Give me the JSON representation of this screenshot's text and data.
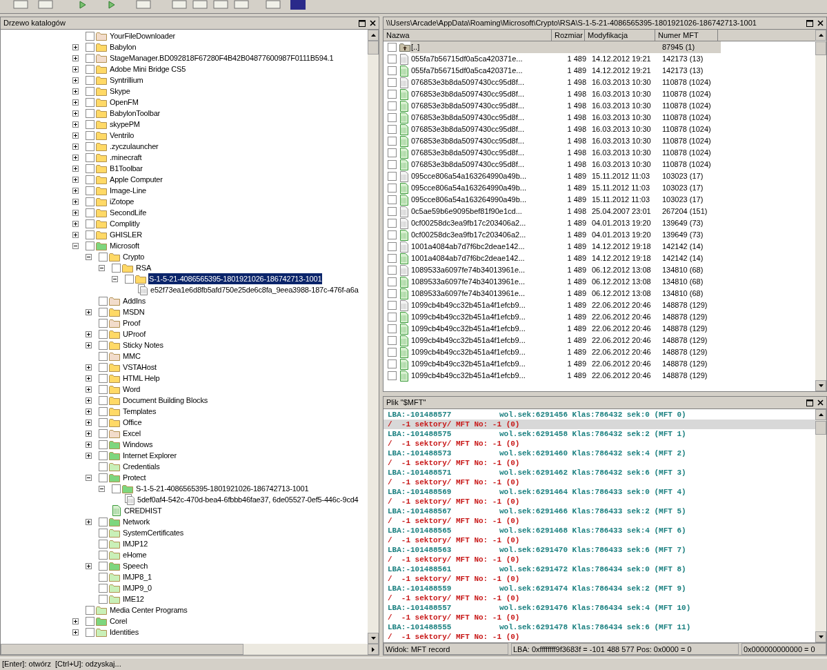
{
  "tree_panel": {
    "title": "Drzewo katalogów",
    "nodes": [
      {
        "label": "YourFileDownloader",
        "kind": "folder",
        "color": "#f2dccb",
        "checked": false,
        "selected": false
      },
      {
        "label": "Babylon",
        "kind": "branch",
        "expanded": false,
        "color": "#ffd966",
        "checked": false,
        "selected": false
      },
      {
        "label": "StageManager.BD092818F67280F4B42B04877600987F0111B594.1",
        "kind": "branch",
        "expanded": false,
        "color": "#f2dccb",
        "checked": false,
        "selected": false
      },
      {
        "label": "Adobe Mini Bridge CS5",
        "kind": "branch",
        "expanded": false,
        "color": "#ffd966",
        "checked": false,
        "selected": false
      },
      {
        "label": "Syntrillium",
        "kind": "branch",
        "expanded": false,
        "color": "#ffd966",
        "checked": false,
        "selected": false
      },
      {
        "label": "Skype",
        "kind": "branch",
        "expanded": false,
        "color": "#ffd966",
        "checked": false,
        "selected": false
      },
      {
        "label": "OpenFM",
        "kind": "branch",
        "expanded": false,
        "color": "#ffd966",
        "checked": false,
        "selected": false
      },
      {
        "label": "BabylonToolbar",
        "kind": "branch",
        "expanded": false,
        "color": "#ffd966",
        "checked": false,
        "selected": false
      },
      {
        "label": "skypePM",
        "kind": "branch",
        "expanded": false,
        "color": "#ffd966",
        "checked": false,
        "selected": false
      },
      {
        "label": "Ventrilo",
        "kind": "branch",
        "expanded": false,
        "color": "#ffd966",
        "checked": false,
        "selected": false
      },
      {
        "label": ".zyczulauncher",
        "kind": "branch",
        "expanded": false,
        "color": "#ffd966",
        "checked": false,
        "selected": false
      },
      {
        "label": ".minecraft",
        "kind": "branch",
        "expanded": false,
        "color": "#ffd966",
        "checked": false,
        "selected": false
      },
      {
        "label": "B1Toolbar",
        "kind": "branch",
        "expanded": false,
        "color": "#ffd966",
        "checked": false,
        "selected": false
      },
      {
        "label": "Apple Computer",
        "kind": "branch",
        "expanded": false,
        "color": "#ffd966",
        "checked": false,
        "selected": false
      },
      {
        "label": "Image-Line",
        "kind": "branch",
        "expanded": false,
        "color": "#ffd966",
        "checked": false,
        "selected": false
      },
      {
        "label": "iZotope",
        "kind": "branch",
        "expanded": false,
        "color": "#ffd966",
        "checked": false,
        "selected": false
      },
      {
        "label": "SecondLife",
        "kind": "branch",
        "expanded": false,
        "color": "#ffd966",
        "checked": false,
        "selected": false
      },
      {
        "label": "Complitly",
        "kind": "branch",
        "expanded": false,
        "color": "#ffd966",
        "checked": false,
        "selected": false
      },
      {
        "label": "GHISLER",
        "kind": "branch",
        "expanded": false,
        "color": "#ffd966",
        "checked": false,
        "selected": false
      },
      {
        "label": "Microsoft",
        "kind": "branch",
        "expanded": true,
        "color": "#7ed67e",
        "checked": false,
        "selected": false,
        "children": [
          {
            "label": "Crypto",
            "kind": "branch",
            "expanded": true,
            "color": "#ffd966",
            "checked": false,
            "selected": false,
            "children": [
              {
                "label": "RSA",
                "kind": "branch",
                "expanded": true,
                "color": "#ffd966",
                "checked": false,
                "selected": false,
                "children": [
                  {
                    "label": "S-1-5-21-4086565395-1801921026-186742713-1001",
                    "kind": "branch",
                    "expanded": true,
                    "color": "#ffd966",
                    "checked": false,
                    "selected": true,
                    "children": [
                      {
                        "label": "e52f73ea1e6d8fb5afd750e25de6c8fa_9eea3988-187c-476f-a6a",
                        "kind": "file-stack",
                        "selected": false
                      }
                    ]
                  }
                ]
              }
            ]
          },
          {
            "label": "AddIns",
            "kind": "folder",
            "color": "#f2dccb",
            "checked": false,
            "selected": false
          },
          {
            "label": "MSDN",
            "kind": "branch",
            "expanded": false,
            "color": "#ffd966",
            "checked": false,
            "selected": false
          },
          {
            "label": "Proof",
            "kind": "folder",
            "color": "#f2dccb",
            "checked": false,
            "selected": false
          },
          {
            "label": "UProof",
            "kind": "branch",
            "expanded": false,
            "color": "#ffd966",
            "checked": false,
            "selected": false
          },
          {
            "label": "Sticky Notes",
            "kind": "branch",
            "expanded": false,
            "color": "#ffd966",
            "checked": false,
            "selected": false
          },
          {
            "label": "MMC",
            "kind": "folder",
            "color": "#f2dccb",
            "checked": false,
            "selected": false
          },
          {
            "label": "VSTAHost",
            "kind": "branch",
            "expanded": false,
            "color": "#ffd966",
            "checked": false,
            "selected": false
          },
          {
            "label": "HTML Help",
            "kind": "branch",
            "expanded": false,
            "color": "#ffd966",
            "checked": false,
            "selected": false
          },
          {
            "label": "Word",
            "kind": "branch",
            "expanded": false,
            "color": "#ffd966",
            "checked": false,
            "selected": false
          },
          {
            "label": "Document Building Blocks",
            "kind": "branch",
            "expanded": false,
            "color": "#ffd966",
            "checked": false,
            "selected": false
          },
          {
            "label": "Templates",
            "kind": "branch",
            "expanded": false,
            "color": "#ffd966",
            "checked": false,
            "selected": false
          },
          {
            "label": "Office",
            "kind": "branch",
            "expanded": false,
            "color": "#ffd966",
            "checked": false,
            "selected": false
          },
          {
            "label": "Excel",
            "kind": "branch",
            "expanded": false,
            "color": "#f2dccb",
            "checked": false,
            "selected": false
          },
          {
            "label": "Windows",
            "kind": "branch",
            "expanded": false,
            "color": "#7ed67e",
            "checked": false,
            "selected": false
          },
          {
            "label": "Internet Explorer",
            "kind": "branch",
            "expanded": false,
            "color": "#7ed67e",
            "checked": false,
            "selected": false
          },
          {
            "label": "Credentials",
            "kind": "folder",
            "color": "#c9f0b8",
            "checked": false,
            "selected": false
          },
          {
            "label": "Protect",
            "kind": "branch",
            "expanded": true,
            "color": "#7ed67e",
            "checked": false,
            "selected": false,
            "children": [
              {
                "label": "S-1-5-21-4086565395-1801921026-186742713-1001",
                "kind": "branch",
                "expanded": true,
                "color": "#7ed67e",
                "checked": false,
                "selected": false,
                "children": [
                  {
                    "label": "5def0af4-542c-470d-bea4-6fbbb46fae37, 6de05527-0ef5-446c-9cd4",
                    "kind": "file-stack",
                    "selected": false
                  }
                ]
              },
              {
                "label": "CREDHIST",
                "kind": "file",
                "selected": false
              }
            ]
          },
          {
            "label": "Network",
            "kind": "branch",
            "expanded": false,
            "color": "#7ed67e",
            "checked": false,
            "selected": false
          },
          {
            "label": "SystemCertificates",
            "kind": "folder",
            "color": "#c9f0b8",
            "checked": false,
            "selected": false
          },
          {
            "label": "IMJP12",
            "kind": "folder",
            "color": "#c9f0b8",
            "checked": false,
            "selected": false
          },
          {
            "label": "eHome",
            "kind": "folder",
            "color": "#c9f0b8",
            "checked": false,
            "selected": false
          },
          {
            "label": "Speech",
            "kind": "branch",
            "expanded": false,
            "color": "#7ed67e",
            "checked": false,
            "selected": false
          },
          {
            "label": "IMJP8_1",
            "kind": "folder",
            "color": "#c9f0b8",
            "checked": false,
            "selected": false
          },
          {
            "label": "IMJP9_0",
            "kind": "folder",
            "color": "#c9f0b8",
            "checked": false,
            "selected": false
          },
          {
            "label": "IME12",
            "kind": "folder",
            "color": "#c9f0b8",
            "checked": false,
            "selected": false
          }
        ]
      },
      {
        "label": "Media Center Programs",
        "kind": "folder",
        "color": "#c9f0b8",
        "checked": false,
        "selected": false
      },
      {
        "label": "Corel",
        "kind": "branch",
        "expanded": false,
        "color": "#7ed67e",
        "checked": false,
        "selected": false
      },
      {
        "label": "Identities",
        "kind": "branch",
        "expanded": false,
        "color": "#c9f0b8",
        "checked": false,
        "selected": false
      }
    ]
  },
  "file_panel": {
    "title": "\\\\Users\\Arcade\\AppData\\Roaming\\Microsoft\\Crypto\\RSA\\S-1-5-21-4086565395-1801921026-186742713-1001",
    "columns": [
      "Nazwa",
      "Rozmiar",
      "Modyfikacja",
      "Numer MFT"
    ],
    "rows": [
      {
        "kind": "parent",
        "name": "[..]",
        "mft": "87945 (1)",
        "checked": false,
        "selected": true
      },
      {
        "kind": "plain",
        "name": "055fa7b56715df0a5ca420371e...",
        "size": "1 489",
        "modified": "14.12.2012 19:21",
        "mft": "142173 (13)",
        "checked": false,
        "selected": false
      },
      {
        "kind": "green",
        "name": "055fa7b56715df0a5ca420371e...",
        "size": "1 489",
        "modified": "14.12.2012 19:21",
        "mft": "142173 (13)",
        "checked": false,
        "selected": false
      },
      {
        "kind": "plain",
        "name": "076853e3b8da5097430cc95d8f...",
        "size": "1 498",
        "modified": "16.03.2013 10:30",
        "mft": "110878 (1024)",
        "checked": false,
        "selected": false
      },
      {
        "kind": "green",
        "name": "076853e3b8da5097430cc95d8f...",
        "size": "1 498",
        "modified": "16.03.2013 10:30",
        "mft": "110878 (1024)",
        "checked": false,
        "selected": false
      },
      {
        "kind": "green",
        "name": "076853e3b8da5097430cc95d8f...",
        "size": "1 498",
        "modified": "16.03.2013 10:30",
        "mft": "110878 (1024)",
        "checked": false,
        "selected": false
      },
      {
        "kind": "green",
        "name": "076853e3b8da5097430cc95d8f...",
        "size": "1 498",
        "modified": "16.03.2013 10:30",
        "mft": "110878 (1024)",
        "checked": false,
        "selected": false
      },
      {
        "kind": "green",
        "name": "076853e3b8da5097430cc95d8f...",
        "size": "1 498",
        "modified": "16.03.2013 10:30",
        "mft": "110878 (1024)",
        "checked": false,
        "selected": false
      },
      {
        "kind": "green",
        "name": "076853e3b8da5097430cc95d8f...",
        "size": "1 498",
        "modified": "16.03.2013 10:30",
        "mft": "110878 (1024)",
        "checked": false,
        "selected": false
      },
      {
        "kind": "green",
        "name": "076853e3b8da5097430cc95d8f...",
        "size": "1 498",
        "modified": "16.03.2013 10:30",
        "mft": "110878 (1024)",
        "checked": false,
        "selected": false
      },
      {
        "kind": "green",
        "name": "076853e3b8da5097430cc95d8f...",
        "size": "1 498",
        "modified": "16.03.2013 10:30",
        "mft": "110878 (1024)",
        "checked": false,
        "selected": false
      },
      {
        "kind": "plain",
        "name": "095cce806a54a163264990a49b...",
        "size": "1 489",
        "modified": "15.11.2012 11:03",
        "mft": "103023 (17)",
        "checked": false,
        "selected": false
      },
      {
        "kind": "green",
        "name": "095cce806a54a163264990a49b...",
        "size": "1 489",
        "modified": "15.11.2012 11:03",
        "mft": "103023 (17)",
        "checked": false,
        "selected": false
      },
      {
        "kind": "green",
        "name": "095cce806a54a163264990a49b...",
        "size": "1 489",
        "modified": "15.11.2012 11:03",
        "mft": "103023 (17)",
        "checked": false,
        "selected": false
      },
      {
        "kind": "plain",
        "name": "0c5ae59b6e9095bef81f90e1cd...",
        "size": "1 498",
        "modified": "25.04.2007 23:01",
        "mft": "267204 (151)",
        "checked": false,
        "selected": false
      },
      {
        "kind": "plain",
        "name": "0cf00258dc3ea9fb17c203406a2...",
        "size": "1 489",
        "modified": "04.01.2013 19:20",
        "mft": "139649 (73)",
        "checked": false,
        "selected": false
      },
      {
        "kind": "green",
        "name": "0cf00258dc3ea9fb17c203406a2...",
        "size": "1 489",
        "modified": "04.01.2013 19:20",
        "mft": "139649 (73)",
        "checked": false,
        "selected": false
      },
      {
        "kind": "plain",
        "name": "1001a4084ab7d7f6bc2deae142...",
        "size": "1 489",
        "modified": "14.12.2012 19:18",
        "mft": "142142 (14)",
        "checked": false,
        "selected": false
      },
      {
        "kind": "green",
        "name": "1001a4084ab7d7f6bc2deae142...",
        "size": "1 489",
        "modified": "14.12.2012 19:18",
        "mft": "142142 (14)",
        "checked": false,
        "selected": false
      },
      {
        "kind": "plain",
        "name": "1089533a6097fe74b34013961e...",
        "size": "1 489",
        "modified": "06.12.2012 13:08",
        "mft": "134810 (68)",
        "checked": false,
        "selected": false
      },
      {
        "kind": "green",
        "name": "1089533a6097fe74b34013961e...",
        "size": "1 489",
        "modified": "06.12.2012 13:08",
        "mft": "134810 (68)",
        "checked": false,
        "selected": false
      },
      {
        "kind": "green",
        "name": "1089533a6097fe74b34013961e...",
        "size": "1 489",
        "modified": "06.12.2012 13:08",
        "mft": "134810 (68)",
        "checked": false,
        "selected": false
      },
      {
        "kind": "plain",
        "name": "1099cb4b49cc32b451a4f1efcb9...",
        "size": "1 489",
        "modified": "22.06.2012 20:46",
        "mft": "148878 (129)",
        "checked": false,
        "selected": false
      },
      {
        "kind": "green",
        "name": "1099cb4b49cc32b451a4f1efcb9...",
        "size": "1 489",
        "modified": "22.06.2012 20:46",
        "mft": "148878 (129)",
        "checked": false,
        "selected": false
      },
      {
        "kind": "green",
        "name": "1099cb4b49cc32b451a4f1efcb9...",
        "size": "1 489",
        "modified": "22.06.2012 20:46",
        "mft": "148878 (129)",
        "checked": false,
        "selected": false
      },
      {
        "kind": "green",
        "name": "1099cb4b49cc32b451a4f1efcb9...",
        "size": "1 489",
        "modified": "22.06.2012 20:46",
        "mft": "148878 (129)",
        "checked": false,
        "selected": false
      },
      {
        "kind": "green",
        "name": "1099cb4b49cc32b451a4f1efcb9...",
        "size": "1 489",
        "modified": "22.06.2012 20:46",
        "mft": "148878 (129)",
        "checked": false,
        "selected": false
      },
      {
        "kind": "green",
        "name": "1099cb4b49cc32b451a4f1efcb9...",
        "size": "1 489",
        "modified": "22.06.2012 20:46",
        "mft": "148878 (129)",
        "checked": false,
        "selected": false
      },
      {
        "kind": "green",
        "name": "1099cb4b49cc32b451a4f1efcb9...",
        "size": "1 489",
        "modified": "22.06.2012 20:46",
        "mft": "148878 (129)",
        "checked": false,
        "selected": false
      }
    ]
  },
  "mft_panel": {
    "title": "Plik \"$MFT\"",
    "lines": [
      {
        "kind": "lba",
        "lba": "LBA:-101488577",
        "detail": "wol.sek:6291456 Klas:786432 sek:0 (MFT 0)",
        "selected": false
      },
      {
        "kind": "error",
        "text": "/  -1 sektory/ MFT No: -1 (0)",
        "selected": true
      },
      {
        "kind": "lba",
        "lba": "LBA:-101488575",
        "detail": "wol.sek:6291458 Klas:786432 sek:2 (MFT 1)",
        "selected": false
      },
      {
        "kind": "error",
        "text": "/  -1 sektory/ MFT No: -1 (0)",
        "selected": false
      },
      {
        "kind": "lba",
        "lba": "LBA:-101488573",
        "detail": "wol.sek:6291460 Klas:786432 sek:4 (MFT 2)",
        "selected": false
      },
      {
        "kind": "error",
        "text": "/  -1 sektory/ MFT No: -1 (0)",
        "selected": false
      },
      {
        "kind": "lba",
        "lba": "LBA:-101488571",
        "detail": "wol.sek:6291462 Klas:786432 sek:6 (MFT 3)",
        "selected": false
      },
      {
        "kind": "error",
        "text": "/  -1 sektory/ MFT No: -1 (0)",
        "selected": false
      },
      {
        "kind": "lba",
        "lba": "LBA:-101488569",
        "detail": "wol.sek:6291464 Klas:786433 sek:0 (MFT 4)",
        "selected": false
      },
      {
        "kind": "error",
        "text": "/  -1 sektory/ MFT No: -1 (0)",
        "selected": false
      },
      {
        "kind": "lba",
        "lba": "LBA:-101488567",
        "detail": "wol.sek:6291466 Klas:786433 sek:2 (MFT 5)",
        "selected": false
      },
      {
        "kind": "error",
        "text": "/  -1 sektory/ MFT No: -1 (0)",
        "selected": false
      },
      {
        "kind": "lba",
        "lba": "LBA:-101488565",
        "detail": "wol.sek:6291468 Klas:786433 sek:4 (MFT 6)",
        "selected": false
      },
      {
        "kind": "error",
        "text": "/  -1 sektory/ MFT No: -1 (0)",
        "selected": false
      },
      {
        "kind": "lba",
        "lba": "LBA:-101488563",
        "detail": "wol.sek:6291470 Klas:786433 sek:6 (MFT 7)",
        "selected": false
      },
      {
        "kind": "error",
        "text": "/  -1 sektory/ MFT No: -1 (0)",
        "selected": false
      },
      {
        "kind": "lba",
        "lba": "LBA:-101488561",
        "detail": "wol.sek:6291472 Klas:786434 sek:0 (MFT 8)",
        "selected": false
      },
      {
        "kind": "error",
        "text": "/  -1 sektory/ MFT No: -1 (0)",
        "selected": false
      },
      {
        "kind": "lba",
        "lba": "LBA:-101488559",
        "detail": "wol.sek:6291474 Klas:786434 sek:2 (MFT 9)",
        "selected": false
      },
      {
        "kind": "error",
        "text": "/  -1 sektory/ MFT No: -1 (0)",
        "selected": false
      },
      {
        "kind": "lba",
        "lba": "LBA:-101488557",
        "detail": "wol.sek:6291476 Klas:786434 sek:4 (MFT 10)",
        "selected": false
      },
      {
        "kind": "error",
        "text": "/  -1 sektory/ MFT No: -1 (0)",
        "selected": false
      },
      {
        "kind": "lba",
        "lba": "LBA:-101488555",
        "detail": "wol.sek:6291478 Klas:786434 sek:6 (MFT 11)",
        "selected": false
      },
      {
        "kind": "error",
        "text": "/  -1 sektory/ MFT No: -1 (0)",
        "selected": false
      }
    ],
    "status": [
      "Widok: MFT record",
      "LBA: 0xffffffff9f3683f = -101 488 577  Pos: 0x0000 = 0",
      "0x000000000000 = 0"
    ]
  },
  "status_bar": "[Enter]: otwórz  [Ctrl+U]: odzyskaj..."
}
